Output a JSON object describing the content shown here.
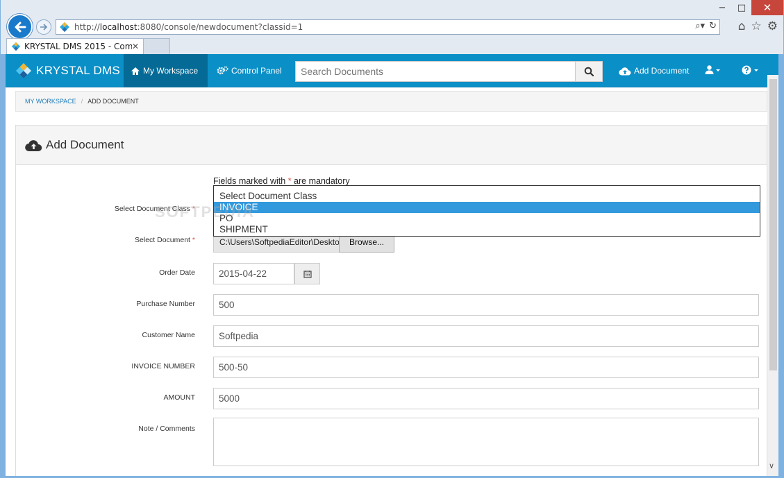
{
  "browser": {
    "url_prefix": "http://",
    "url_host": "localhost",
    "url_rest": ":8080/console/newdocument?classid=1",
    "tab_title": "KRYSTAL DMS 2015 - Com...",
    "min_glyph": "−",
    "max_glyph": "□",
    "close_glyph": "✕",
    "search_glyph": "⌕▾",
    "refresh_glyph": "↻",
    "home_glyph": "⌂",
    "fav_glyph": "☆",
    "settings_glyph": "⚙",
    "tab_close_glyph": "✕"
  },
  "navbar": {
    "brand": "KRYSTAL DMS",
    "my_workspace": "My Workspace",
    "control_panel": "Control Panel",
    "search_placeholder": "Search Documents",
    "add_document": "Add Document"
  },
  "breadcrumb": {
    "home": "MY WORKSPACE",
    "separator": "/",
    "current": "ADD DOCUMENT"
  },
  "panel": {
    "title": "Add Document"
  },
  "form": {
    "mandatory_prefix": "Fields marked with ",
    "mandatory_star": "*",
    "mandatory_suffix": " are mandatory",
    "labels": {
      "document_class": "Select Document Class",
      "document": "Select Document",
      "order_date": "Order Date",
      "purchase_number": "Purchase Number",
      "customer_name": "Customer Name",
      "invoice_number": "INVOICE NUMBER",
      "amount": "AMOUNT",
      "notes": "Note / Comments"
    },
    "required_star": "*",
    "document_class_options": [
      "Select Document Class",
      "INVOICE",
      "PO",
      "SHIPMENT"
    ],
    "document_class_selected": "INVOICE",
    "file_path": "C:\\Users\\SoftpediaEditor\\Desktop",
    "browse_label": "Browse...",
    "order_date": "2015-04-22",
    "purchase_number": "500",
    "customer_name": "Softpedia",
    "invoice_number": "500-50",
    "amount": "5000",
    "notes": ""
  },
  "watermark": "SOFTPEDIA",
  "scroll_down_glyph": "∨",
  "colors": {
    "navbar": "#0b8fc7",
    "navbar_active": "#056a96",
    "selected_option": "#3399dd",
    "required": "#d9534f",
    "link": "#1f7db8"
  }
}
